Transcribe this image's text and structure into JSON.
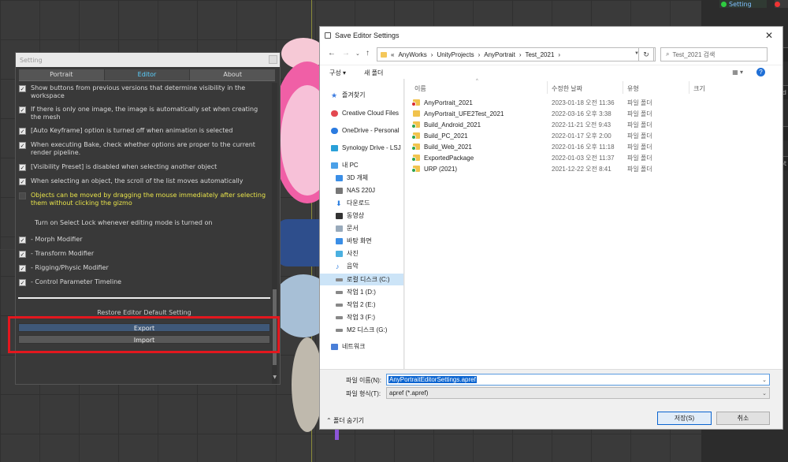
{
  "settings_panel": {
    "title": "Setting",
    "tabs": [
      {
        "label": "Portrait",
        "active": false
      },
      {
        "label": "Editor",
        "active": true
      },
      {
        "label": "About",
        "active": false
      }
    ],
    "options": [
      {
        "text": "Show buttons from previous versions that determine visibility in the workspace",
        "checked": true,
        "highlight": false
      },
      {
        "text": "If there is only one image, the image is automatically set when creating the mesh",
        "checked": true,
        "highlight": false
      },
      {
        "text": "[Auto Keyframe] option is turned off when animation is selected",
        "checked": true,
        "highlight": false
      },
      {
        "text": "When executing Bake, check whether options are proper to the current render pipeline.",
        "checked": true,
        "highlight": false
      },
      {
        "text": "[Visibility Preset] is disabled when selecting another object",
        "checked": true,
        "highlight": false
      },
      {
        "text": "When selecting an object, the scroll of the list moves automatically",
        "checked": true,
        "highlight": false
      },
      {
        "text": "Objects can be moved by dragging the mouse immediately after selecting them without clicking the gizmo",
        "checked": false,
        "highlight": true
      }
    ],
    "select_lock_label": "Turn on Select Lock whenever editing mode is turned on",
    "lock_options": [
      {
        "text": "- Morph Modifier",
        "checked": true
      },
      {
        "text": "- Transform Modifier",
        "checked": true
      },
      {
        "text": "- Rigging/Physic Modifier",
        "checked": true
      },
      {
        "text": "- Control Parameter Timeline",
        "checked": true
      }
    ],
    "restore_label": "Restore Editor Default Setting",
    "export_label": "Export",
    "import_label": "Import",
    "highlight_color": "#e3171e"
  },
  "dialog": {
    "title": "Save Editor Settings",
    "breadcrumb": [
      "«",
      "AnyWorks",
      "›",
      "UnityProjects",
      "›",
      "AnyPortrait",
      "›",
      "Test_2021",
      "›"
    ],
    "search_placeholder": "Test_2021 검색",
    "toolbar": {
      "organize": "구성 ▾",
      "new_folder": "새 폴더",
      "view": "▦ ▾",
      "help": "?"
    },
    "nav_items": [
      {
        "label": "즐겨찾기",
        "icon": "star"
      },
      {
        "label": "Creative Cloud Files",
        "icon": "cloud"
      },
      {
        "label": "OneDrive - Personal",
        "icon": "cloud"
      },
      {
        "label": "Synology Drive - LSJ",
        "icon": "gray"
      },
      {
        "label": "내 PC",
        "icon": "pc"
      },
      {
        "label": "3D 개체",
        "icon": "blue"
      },
      {
        "label": "NAS 220J",
        "icon": "gray"
      },
      {
        "label": "다운로드",
        "icon": "down"
      },
      {
        "label": "동영상",
        "icon": "gray"
      },
      {
        "label": "문서",
        "icon": "gray"
      },
      {
        "label": "바탕 화면",
        "icon": "blue"
      },
      {
        "label": "사진",
        "icon": "blue"
      },
      {
        "label": "음악",
        "icon": "music"
      },
      {
        "label": "로컬 디스크 (C:)",
        "icon": "drive"
      },
      {
        "label": "작업 1 (D:)",
        "icon": "drive"
      },
      {
        "label": "작업 2 (E:)",
        "icon": "drive"
      },
      {
        "label": "작업 3 (F:)",
        "icon": "drive"
      },
      {
        "label": "M2 디스크 (G:)",
        "icon": "drive"
      },
      {
        "label": "네트워크",
        "icon": "net"
      }
    ],
    "selected_nav_index": 13,
    "columns": {
      "name": "이름",
      "date": "수정한 날짜",
      "type": "유형",
      "size": "크기"
    },
    "files": [
      {
        "name": "AnyPortrait_2021",
        "date": "2023-01-18 오전 11:36",
        "type": "파일 폴더",
        "badge": "red"
      },
      {
        "name": "AnyPortrait_UFE2Test_2021",
        "date": "2022-03-16 오후 3:38",
        "type": "파일 폴더",
        "badge": "none"
      },
      {
        "name": "Build_Android_2021",
        "date": "2022-11-21 오전 9:43",
        "type": "파일 폴더",
        "badge": "green"
      },
      {
        "name": "Build_PC_2021",
        "date": "2022-01-17 오후 2:00",
        "type": "파일 폴더",
        "badge": "green"
      },
      {
        "name": "Build_Web_2021",
        "date": "2022-01-16 오후 11:18",
        "type": "파일 폴더",
        "badge": "green"
      },
      {
        "name": "ExportedPackage",
        "date": "2022-01-03 오전 11:37",
        "type": "파일 폴더",
        "badge": "green"
      },
      {
        "name": "URP (2021)",
        "date": "2021-12-22 오전 8:41",
        "type": "파일 폴더",
        "badge": "green"
      }
    ],
    "filename_label": "파일 이름(N):",
    "filename_value": "AnyPortraitEditorSettings.apref",
    "filetype_label": "파일 형식(T):",
    "filetype_value": "apref (*.apref)",
    "hide_folders_label": "폴더 숨기기",
    "save_label": "저장(S)",
    "cancel_label": "취소"
  },
  "unity_right": {
    "setting_tab": "Setting",
    "row_labels": [
      "oad",
      "Root"
    ]
  }
}
